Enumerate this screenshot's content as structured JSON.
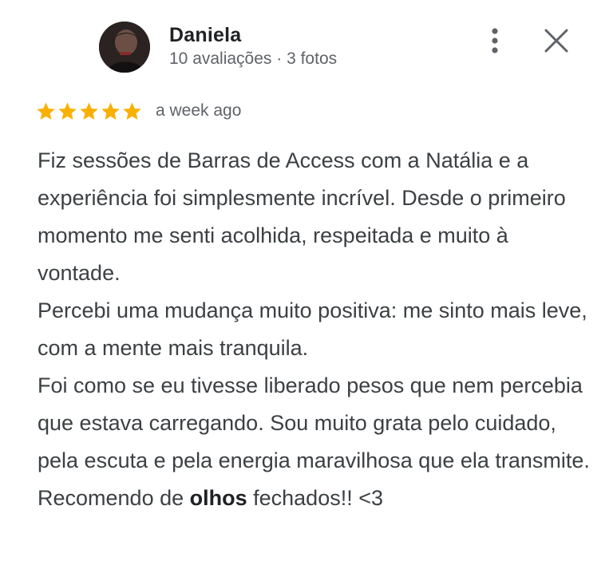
{
  "author": {
    "name": "Daniela",
    "meta": "10 avaliações · 3 fotos"
  },
  "review": {
    "rating": 5,
    "max_rating": 5,
    "date": "a week ago",
    "paragraphs": [
      "Fiz sessões de Barras de Access com a Natália e a experiência foi simplesmente incrível. Desde o primeiro momento me senti acolhida, respeitada e muito à vontade.",
      "Percebi uma mudança muito positiva: me sinto mais leve, com a mente mais tranquila.",
      "Foi como se eu tivesse liberado pesos que nem percebia que estava carregando. Sou muito grata pelo cuidado, pela escuta e pela energia maravilhosa que ela transmite."
    ],
    "closing": {
      "before": "Recomendo de ",
      "bold": "olhos",
      "after": " fechados!! <3"
    }
  },
  "icons": {
    "star": "star-icon",
    "more": "more-vert-icon",
    "close": "close-icon"
  },
  "colors": {
    "star": "#F9B000",
    "name": "#202124",
    "meta": "#5F6368",
    "body": "#3C4043",
    "icon": "#5F6368"
  }
}
